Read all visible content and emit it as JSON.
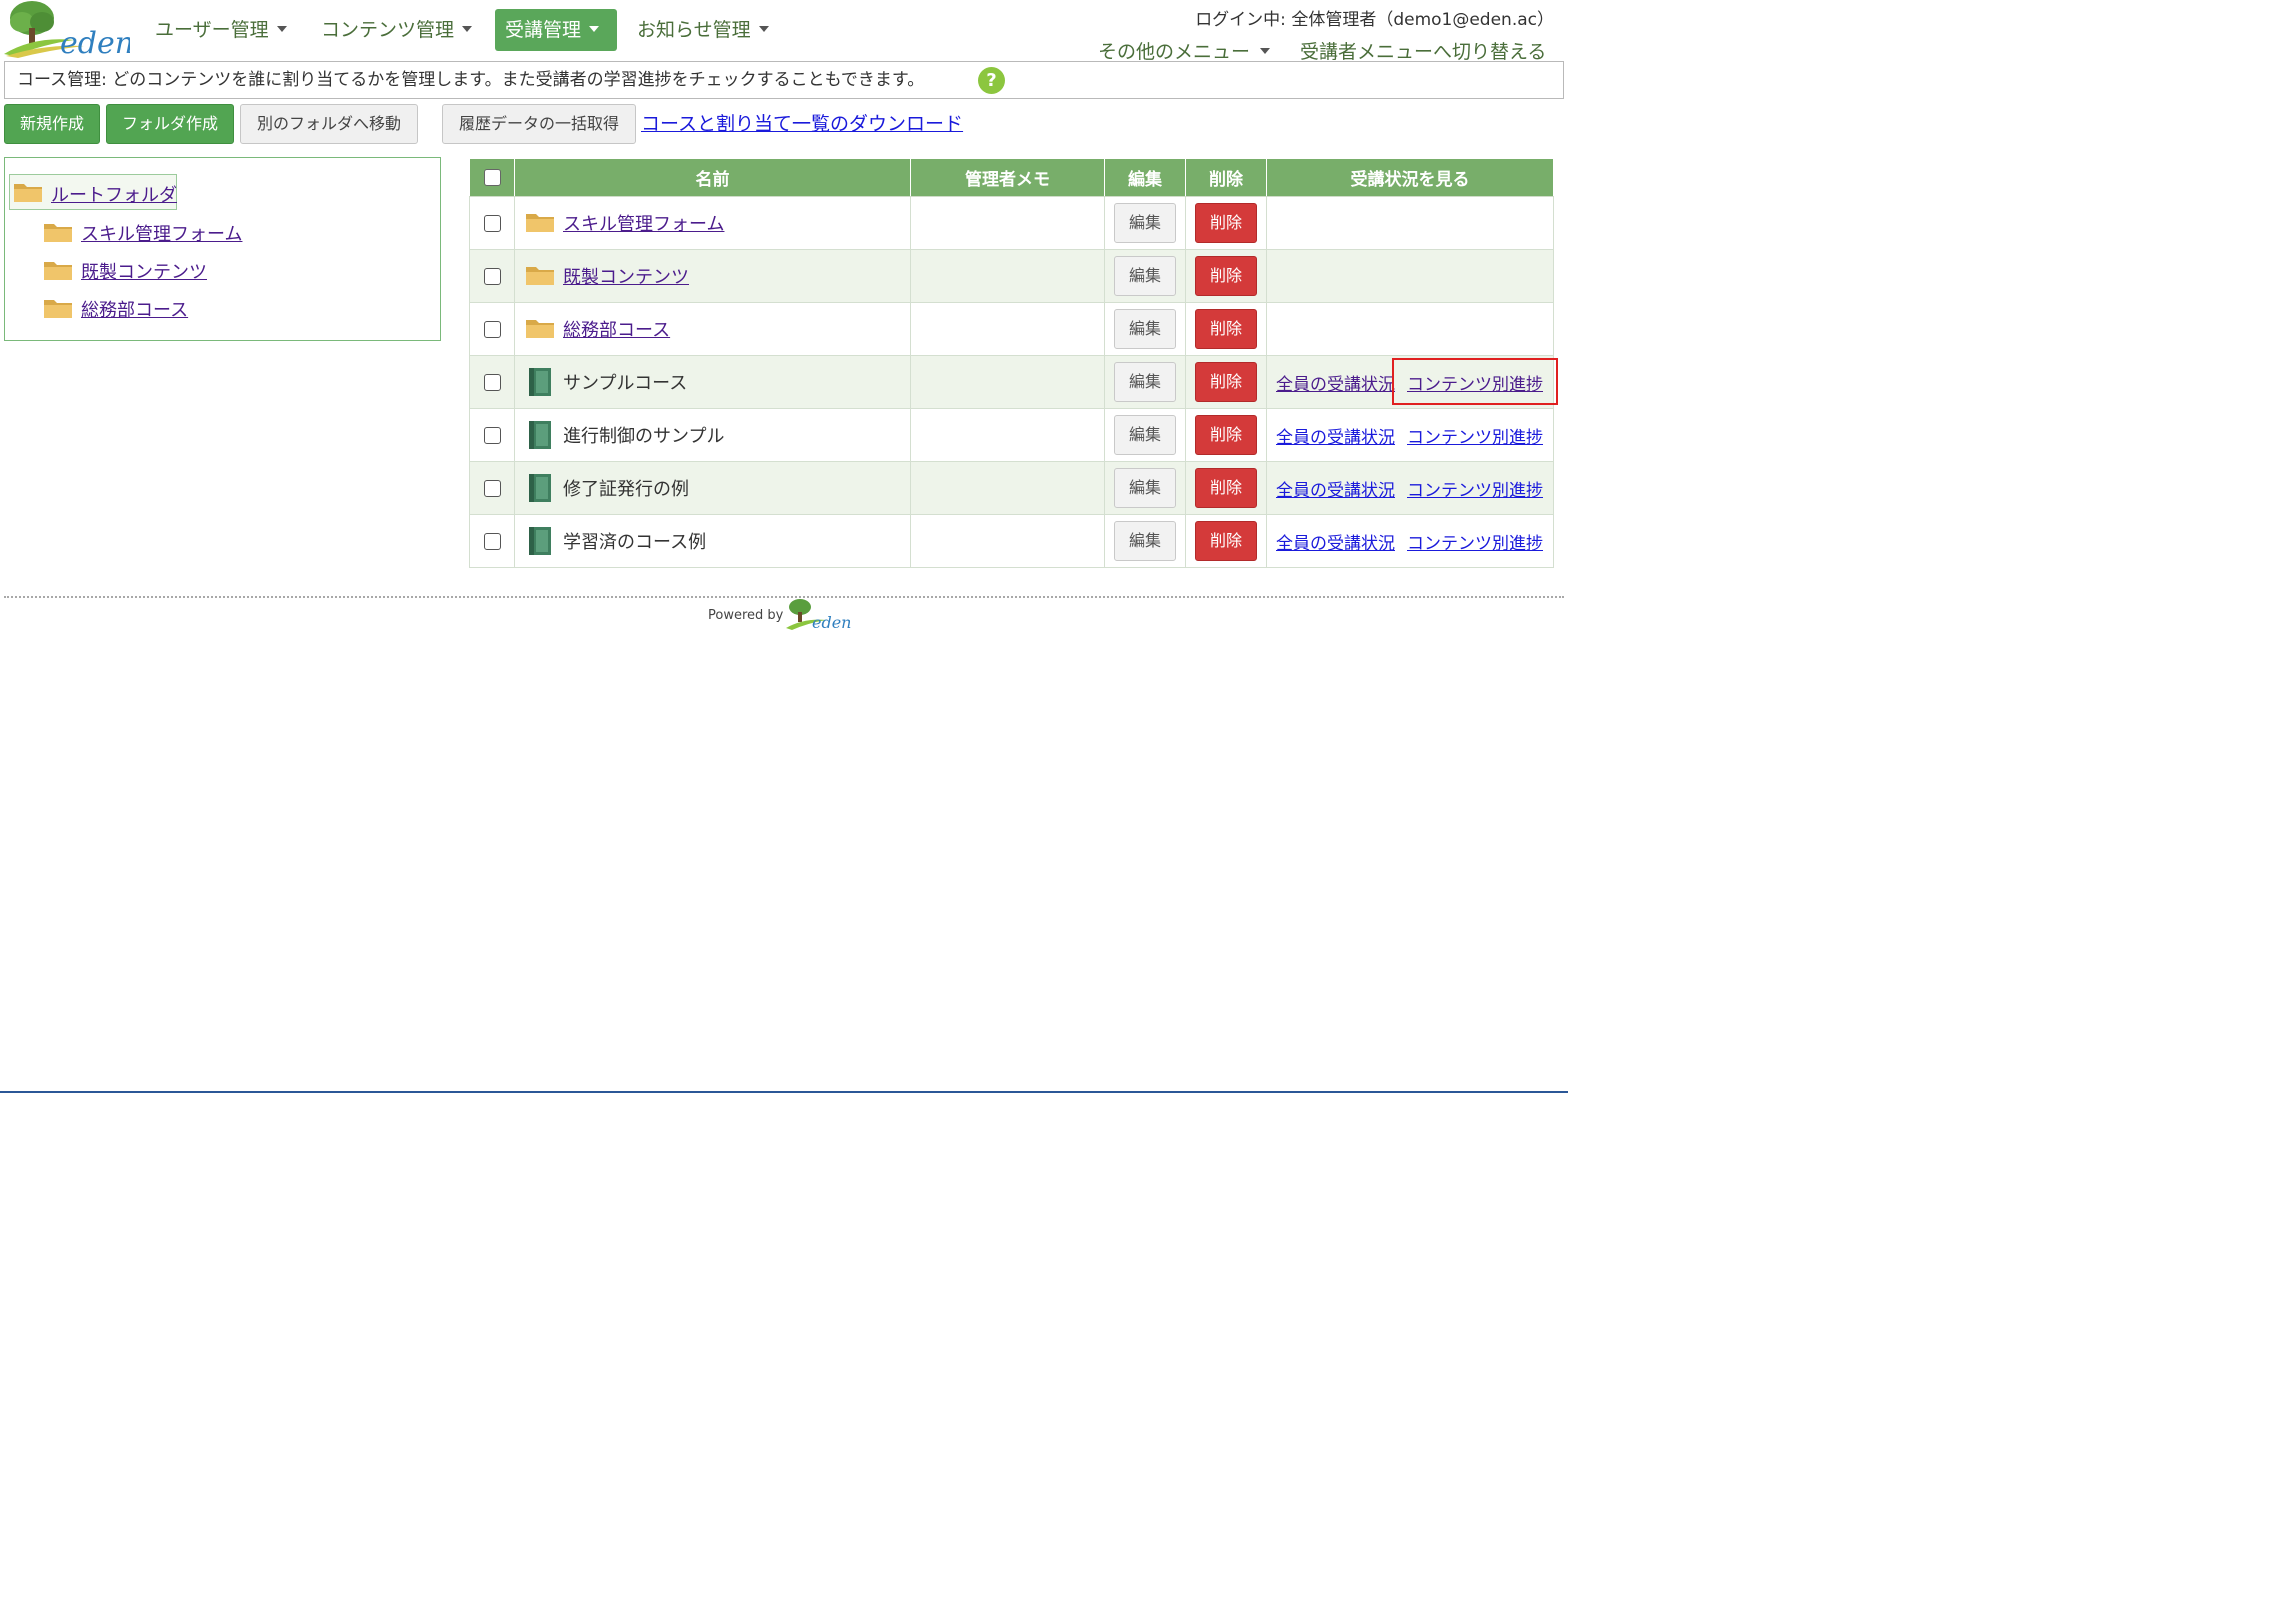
{
  "brand": {
    "logo_text": "eden"
  },
  "nav": {
    "items": [
      {
        "label": "ユーザー管理",
        "active": false
      },
      {
        "label": "コンテンツ管理",
        "active": false
      },
      {
        "label": "受講管理",
        "active": true
      },
      {
        "label": "お知らせ管理",
        "active": false
      }
    ]
  },
  "header": {
    "login_info": "ログイン中: 全体管理者（demo1@eden.ac）",
    "other_menu": "その他のメニュー",
    "switch_menu": "受講者メニューへ切り替える"
  },
  "description": {
    "text": "コース管理: どのコンテンツを誰に割り当てるかを管理します。また受講者の学習進捗をチェックすることもできます。",
    "help_icon": "question-mark-icon"
  },
  "toolbar": {
    "new_label": "新規作成",
    "folder_label": "フォルダ作成",
    "move_label": "別のフォルダへ移動",
    "history_label": "履歴データの一括取得",
    "download_link": "コースと割り当て一覧のダウンロード"
  },
  "tree": {
    "root": "ルートフォルダ",
    "children": [
      "スキル管理フォーム",
      "既製コンテンツ",
      "総務部コース"
    ]
  },
  "table": {
    "headers": {
      "name": "名前",
      "memo": "管理者メモ",
      "edit": "編集",
      "delete": "削除",
      "status": "受講状況を見る"
    },
    "edit_label": "編集",
    "delete_label": "削除",
    "rows": [
      {
        "type": "folder",
        "name": "スキル管理フォーム",
        "memo": "",
        "all_status": "",
        "content_progress": ""
      },
      {
        "type": "folder",
        "name": "既製コンテンツ",
        "memo": "",
        "all_status": "",
        "content_progress": ""
      },
      {
        "type": "folder",
        "name": "総務部コース",
        "memo": "",
        "all_status": "",
        "content_progress": ""
      },
      {
        "type": "course",
        "name": "サンプルコース",
        "memo": "",
        "all_status": "全員の受講状況",
        "content_progress": "コンテンツ別進捗"
      },
      {
        "type": "course",
        "name": "進行制御のサンプル",
        "memo": "",
        "all_status": "全員の受講状況",
        "content_progress": "コンテンツ別進捗"
      },
      {
        "type": "course",
        "name": "修了証発行の例",
        "memo": "",
        "all_status": "全員の受講状況",
        "content_progress": "コンテンツ別進捗"
      },
      {
        "type": "course",
        "name": "学習済のコース例",
        "memo": "",
        "all_status": "全員の受講状況",
        "content_progress": "コンテンツ別進捗"
      }
    ]
  },
  "footer": {
    "powered_by": "Powered by",
    "logo_text": "eden"
  },
  "colors": {
    "brand_green": "#52a552",
    "header_green": "#78ae6a",
    "delete_red": "#d43a3a",
    "link_blue": "#1a1adb",
    "visited_purple": "#4b1c8c",
    "highlight_red": "#e02020"
  }
}
